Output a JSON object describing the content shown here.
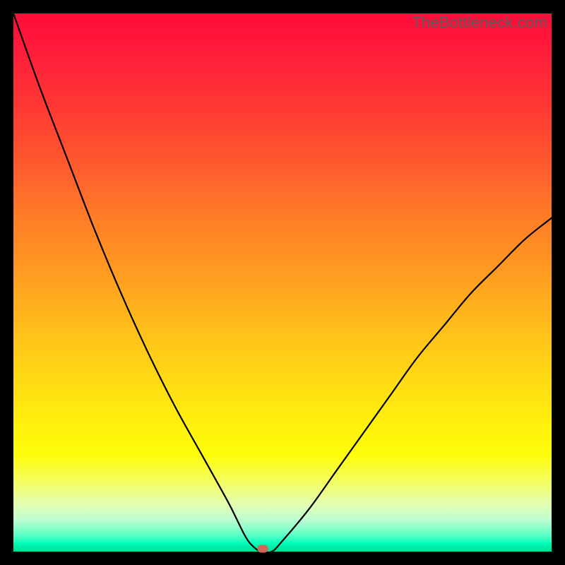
{
  "watermark": "TheBottleneck.com",
  "chart_data": {
    "type": "line",
    "title": "",
    "xlabel": "",
    "ylabel": "",
    "x_range": [
      0,
      100
    ],
    "y_range": [
      0,
      100
    ],
    "notes": "V-shaped bottleneck curve over red-yellow-green vertical gradient. Minimum near x≈46.",
    "series": [
      {
        "name": "bottleneck-curve",
        "x": [
          0,
          5,
          10,
          15,
          20,
          25,
          30,
          35,
          40,
          43,
          44.5,
          46,
          48,
          50,
          55,
          60,
          65,
          70,
          75,
          80,
          85,
          90,
          95,
          100
        ],
        "y": [
          100,
          86,
          73,
          60,
          48,
          37,
          27,
          18,
          9,
          3,
          1,
          0,
          0,
          2,
          8,
          15,
          22,
          29,
          36,
          42,
          48,
          53,
          58,
          62
        ]
      }
    ],
    "marker": {
      "x": 46.3,
      "y": 0.5,
      "color": "#cf6858"
    },
    "gradient_stops": [
      {
        "pos": 0,
        "color": "#ff0b3a"
      },
      {
        "pos": 0.5,
        "color": "#ffa120"
      },
      {
        "pos": 0.8,
        "color": "#fdfd0a"
      },
      {
        "pos": 1.0,
        "color": "#00dd95"
      }
    ]
  }
}
